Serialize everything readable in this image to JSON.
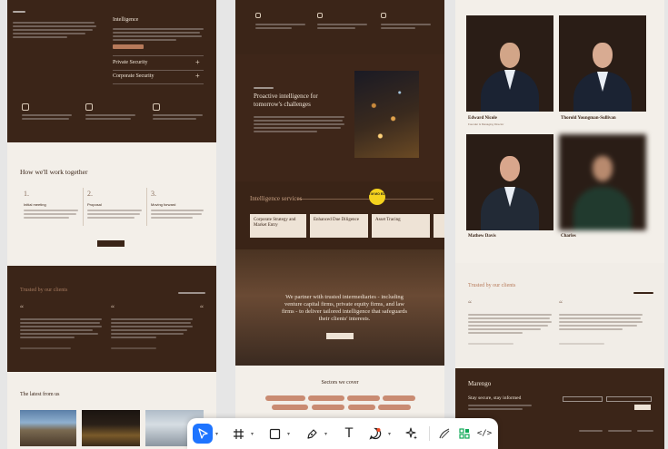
{
  "frame1": {
    "accordion": [
      {
        "label": "Intelligence",
        "icon": "minus-icon"
      },
      {
        "label": "Private Security",
        "icon": "plus-icon"
      },
      {
        "label": "Corporate Security",
        "icon": "plus-icon"
      }
    ],
    "how_title": "How we'll work together",
    "steps": [
      {
        "num": "1.",
        "title": "Initial meeting"
      },
      {
        "num": "2.",
        "title": "Proposal"
      },
      {
        "num": "3.",
        "title": "Moving forward"
      }
    ],
    "trusted_title": "Trusted by our clients",
    "latest_title": "The latest from us"
  },
  "frame2": {
    "intel_title": "Proactive intelligence for tomorrow's challenges",
    "services_title": "Intelligence services",
    "badge": "I M MO ED",
    "services": [
      "Corporate Strategy and Market Entry",
      "Enhanced Due Diligence",
      "Asset Tracing"
    ],
    "partner_text": "We partner with trusted intermediaries - including venture capital firms, private equity firms, and law firms - to deliver tailored intelligence that safeguards their clients' interests.",
    "sectors_title": "Sectors we cover"
  },
  "frame3": {
    "team": [
      {
        "name": "Edward Nicole",
        "role": "Founder & Managing Director"
      },
      {
        "name": "Thorold Youngman-Sullivan",
        "role": ""
      },
      {
        "name": "Mathew Davis",
        "role": ""
      },
      {
        "name": "Charles",
        "role": ""
      }
    ],
    "trusted_title": "Trusted by our clients",
    "logo": "Marengo",
    "stay": "Stay secure, stay informed"
  },
  "toolbar": {
    "tools": [
      {
        "name": "move-tool",
        "icon": "cursor-icon",
        "active": true
      },
      {
        "name": "frame-tool",
        "icon": "frame-icon"
      },
      {
        "name": "shape-tool",
        "icon": "square-icon"
      },
      {
        "name": "pen-tool",
        "icon": "pen-icon"
      },
      {
        "name": "text-tool",
        "icon": "text-icon"
      },
      {
        "name": "comment-tool",
        "icon": "comment-icon"
      },
      {
        "name": "ai-tool",
        "icon": "sparkle-icon"
      },
      {
        "name": "draw-mode",
        "icon": "draw-icon"
      },
      {
        "name": "dev-mode",
        "icon": "dev-icon"
      },
      {
        "name": "code-mode",
        "icon": "code-icon"
      }
    ],
    "text_glyph": "T",
    "code_glyph": "</>",
    "colors": {
      "active": "#1e74ff",
      "dev_green": "#0fa958"
    }
  },
  "colors": {
    "dark_brown": "#3b2518",
    "cream": "#f3efe9",
    "accent": "#b77a5a"
  }
}
